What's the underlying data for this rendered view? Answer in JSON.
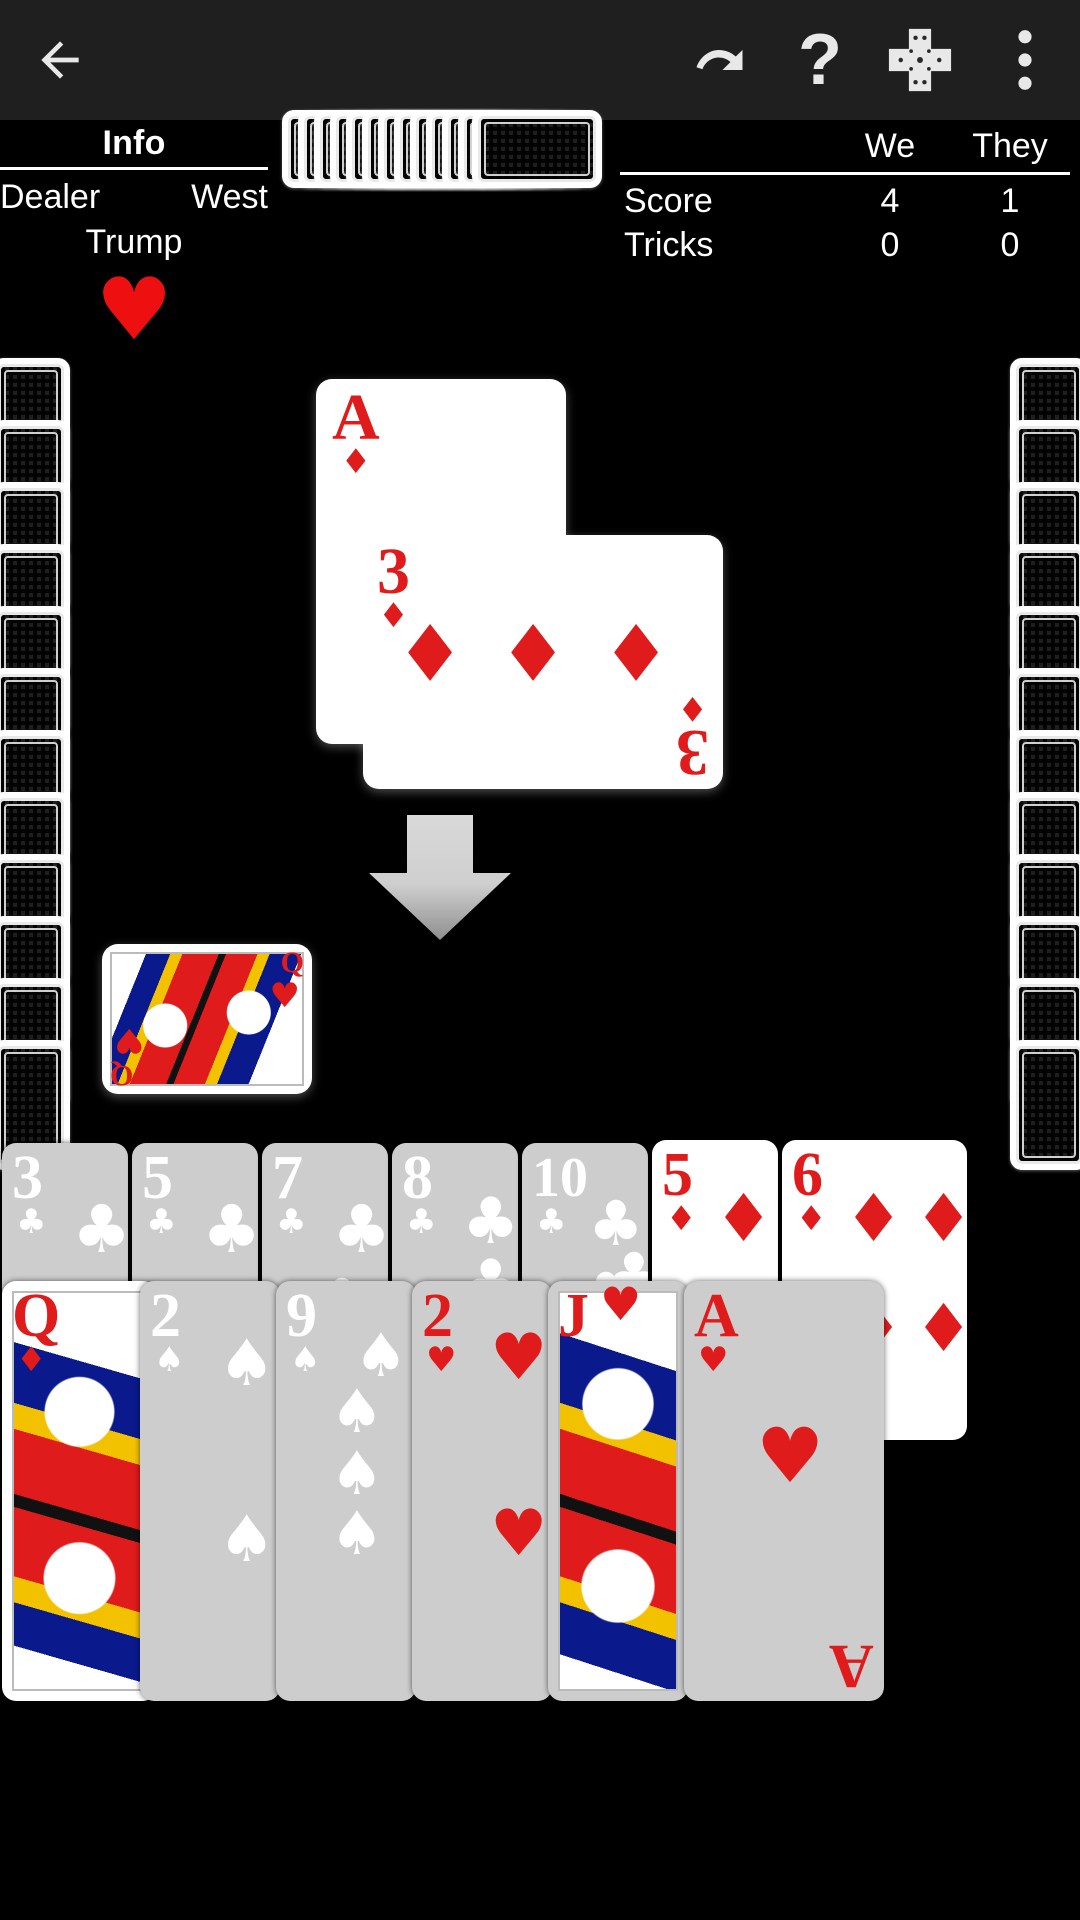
{
  "appbar": {
    "back_icon": "arrow-back-icon",
    "undo_icon": "undo-icon",
    "help_icon": "help-question-icon",
    "cards_icon": "cards-cross-icon",
    "overflow_icon": "overflow-menu-icon"
  },
  "info": {
    "title": "Info",
    "dealer_label": "Dealer",
    "dealer_value": "West",
    "trump_label": "Trump",
    "trump_suit": "♥",
    "trump_suit_name": "hearts",
    "trump_color": "#ee1010"
  },
  "score": {
    "col_we": "We",
    "col_they": "They",
    "rows": [
      {
        "label": "Score",
        "we": "4",
        "they": "1"
      },
      {
        "label": "Tricks",
        "we": "0",
        "they": "0"
      }
    ]
  },
  "table": {
    "lead_arrow_name": "lead-direction-arrow",
    "played": [
      {
        "pos": "north",
        "rank": "A",
        "suit": "♦",
        "color": "#e01b1b",
        "rotated": false
      },
      {
        "pos": "east",
        "rank": "3",
        "suit": "♦",
        "color": "#e01b1b",
        "rotated": true
      },
      {
        "pos": "west",
        "rank": "Q",
        "suit": "♥",
        "color": "#e01b1b",
        "face": "queen",
        "rotated": true
      }
    ]
  },
  "opponents": {
    "left_hand_count": 12,
    "right_hand_count": 12,
    "deck_count": 12
  },
  "hand": {
    "row_top": [
      {
        "rank": "3",
        "suit": "♣",
        "color": "#000000",
        "playable": false
      },
      {
        "rank": "5",
        "suit": "♣",
        "color": "#000000",
        "playable": false
      },
      {
        "rank": "7",
        "suit": "♣",
        "color": "#000000",
        "playable": false
      },
      {
        "rank": "8",
        "suit": "♣",
        "color": "#000000",
        "playable": false
      },
      {
        "rank": "10",
        "suit": "♣",
        "color": "#000000",
        "playable": false
      },
      {
        "rank": "5",
        "suit": "♦",
        "color": "#e01b1b",
        "playable": true
      },
      {
        "rank": "6",
        "suit": "♦",
        "color": "#e01b1b",
        "playable": true
      }
    ],
    "row_bottom": [
      {
        "rank": "Q",
        "suit": "♦",
        "color": "#e01b1b",
        "playable": true,
        "face": "queen"
      },
      {
        "rank": "2",
        "suit": "♠",
        "color": "#000000",
        "playable": false
      },
      {
        "rank": "9",
        "suit": "♠",
        "color": "#000000",
        "playable": false
      },
      {
        "rank": "2",
        "suit": "♥",
        "color": "#e01b1b",
        "playable": false
      },
      {
        "rank": "J",
        "suit": "♥",
        "color": "#e01b1b",
        "playable": false,
        "face": "jack"
      },
      {
        "rank": "A",
        "suit": "♥",
        "color": "#e01b1b",
        "playable": false
      }
    ]
  }
}
